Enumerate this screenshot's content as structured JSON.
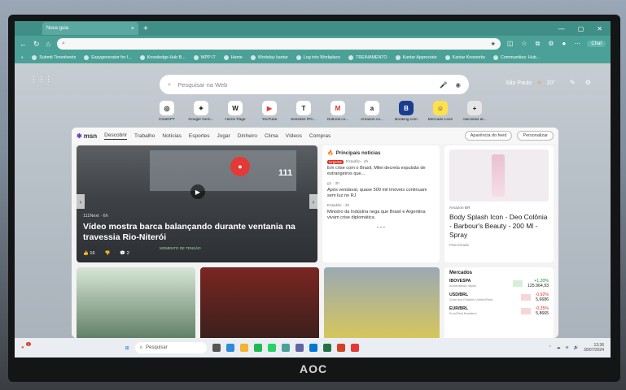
{
  "browser": {
    "tab_title": "Nova guia",
    "tab_close": "×",
    "new_tab": "+",
    "address_placeholder": "",
    "chat_label": "Chat"
  },
  "favorites": [
    "Submit Timesheets",
    "Easygenerator for I...",
    "Knowledge Hub B...",
    "WPP IT",
    "Home",
    "Workday kantar",
    "Log into Workplace",
    "TREINAMENTO",
    "Kantar Appreciate",
    "Kantar Knoworks",
    "Communities: Hub..."
  ],
  "search": {
    "placeholder": "Pesquisar na Web"
  },
  "weather": {
    "city": "São Paulo",
    "temp": "20°"
  },
  "quick_links": [
    {
      "label": "ChatGPT",
      "glyph": "◎"
    },
    {
      "label": "Google Gem...",
      "glyph": "✦"
    },
    {
      "label": "Home Page",
      "glyph": "W"
    },
    {
      "label": "YouTube",
      "glyph": "▶"
    },
    {
      "label": "Sessões IPC...",
      "glyph": "T"
    },
    {
      "label": "Outlook.co...",
      "glyph": "M"
    },
    {
      "label": "Amazon.co...",
      "glyph": "a"
    },
    {
      "label": "Booking.com",
      "glyph": "B"
    },
    {
      "label": "Mercado Livre",
      "glyph": "☺"
    },
    {
      "label": "Adicionar at...",
      "glyph": "+"
    }
  ],
  "feed": {
    "brand": "msn",
    "nav": [
      "Descobrir",
      "Trabalho",
      "Notícias",
      "Esportes",
      "Jogar",
      "Dinheiro",
      "Clima",
      "Vídeos",
      "Compras"
    ],
    "btn_appearance": "Aparência do feed",
    "btn_personalize": "Personalizar",
    "hero": {
      "source": "111Next · 6h",
      "title": "Vídeo mostra barca balançando durante ventania na travessia Rio-Niterói",
      "likes": "16",
      "comments": "2",
      "counter": "111",
      "tag": "MOMENTO DE TENSÃO"
    },
    "top_news": {
      "heading": "Principais notícias",
      "items": [
        {
          "badge": "Urgente",
          "source": "Estadão · 4h",
          "text": "Em crise com o Brasil, Milei decreta expulsão de estrangeiros que..."
        },
        {
          "badge": "",
          "source": "g1 · 2h",
          "text": "Após vendaval, quase 500 mil imóveis continuam sem luz no RJ"
        },
        {
          "badge": "",
          "source": "Estadão · 2h",
          "text": "Ministro da Indústria nega que Brasil e Argentina vivam crise diplomática"
        }
      ]
    },
    "ad": {
      "brand": "Amazon BR",
      "title": "Body Splash Icon - Deo Colônia - Barbour's Beauty - 200 Ml - Spray",
      "sponsored": "Patrocinado"
    },
    "markets": {
      "heading": "Mercados",
      "rows": [
        {
          "name": "IBOVESPA",
          "sub": "Aumentando rápido",
          "change": "+1,20%",
          "value": "125.964,93",
          "dir": "up"
        },
        {
          "name": "USD/BRL",
          "sub": "Dólar dos Estados Unidos/Real...",
          "change": "-0,92%",
          "value": "5,6686",
          "dir": "down"
        },
        {
          "name": "EUR/BRL",
          "sub": "Euro/Real Brasileiro",
          "change": "-0,35%",
          "value": "5,8665",
          "dir": "down"
        }
      ]
    }
  },
  "taskbar": {
    "search_label": "Pesquisar",
    "time": "13:36",
    "date": "30/07/2024"
  },
  "monitor_brand": "AOC",
  "notification_count": "2"
}
